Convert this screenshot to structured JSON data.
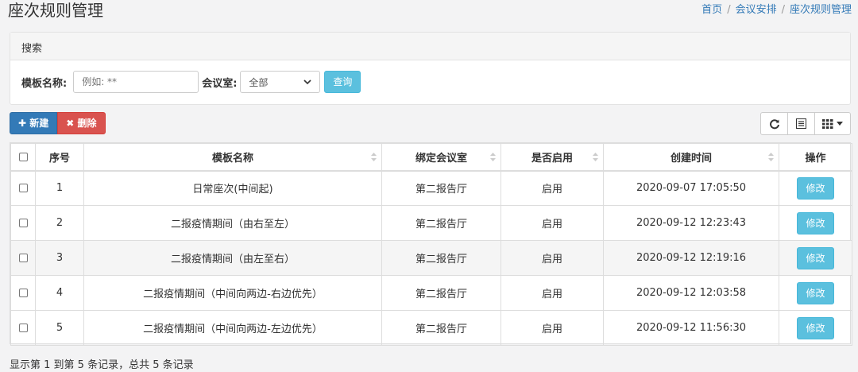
{
  "header": {
    "title": "座次规则管理",
    "breadcrumb": [
      "首页",
      "会议安排",
      "座次规则管理"
    ]
  },
  "search": {
    "heading": "搜索",
    "template_label": "模板名称:",
    "template_placeholder": "例如: **",
    "room_label": "会议室:",
    "room_selected": "全部",
    "query_button": "查询"
  },
  "toolbar": {
    "new_label": "新建",
    "delete_label": "删除"
  },
  "table": {
    "columns": [
      "序号",
      "模板名称",
      "绑定会议室",
      "是否启用",
      "创建时间",
      "操作"
    ],
    "rows": [
      {
        "no": "1",
        "name": "日常座次(中间起)",
        "room": "第二报告厅",
        "enabled": "启用",
        "created": "2020-09-07 17:05:50",
        "action": "修改"
      },
      {
        "no": "2",
        "name": "二报疫情期间（由右至左）",
        "room": "第二报告厅",
        "enabled": "启用",
        "created": "2020-09-12 12:23:43",
        "action": "修改"
      },
      {
        "no": "3",
        "name": "二报疫情期间（由左至右）",
        "room": "第二报告厅",
        "enabled": "启用",
        "created": "2020-09-12 12:19:16",
        "action": "修改"
      },
      {
        "no": "4",
        "name": "二报疫情期间（中间向两边-右边优先）",
        "room": "第二报告厅",
        "enabled": "启用",
        "created": "2020-09-12 12:03:58",
        "action": "修改"
      },
      {
        "no": "5",
        "name": "二报疫情期间（中间向两边-左边优先）",
        "room": "第二报告厅",
        "enabled": "启用",
        "created": "2020-09-12 11:56:30",
        "action": "修改"
      }
    ]
  },
  "footer": {
    "summary": "显示第 1 到第 5 条记录，总共 5 条记录"
  },
  "colors": {
    "primary": "#337ab7",
    "danger": "#d9534f",
    "info": "#5bc0de"
  }
}
